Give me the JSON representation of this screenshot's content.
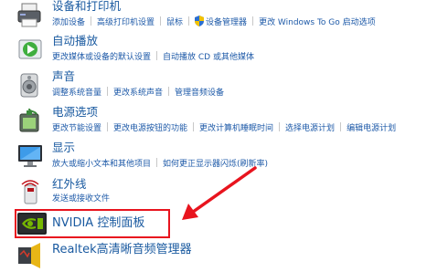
{
  "categories": [
    {
      "title": "设备和打印机",
      "icon": "printer-icon",
      "links": [
        "添加设备",
        "高级打印机设置",
        "鼠标",
        "设备管理器",
        "更改 Windows To Go 启动选项"
      ]
    },
    {
      "title": "自动播放",
      "icon": "autoplay-icon",
      "links": [
        "更改媒体或设备的默认设置",
        "自动播放 CD 或其他媒体"
      ]
    },
    {
      "title": "声音",
      "icon": "speaker-icon",
      "links": [
        "调整系统音量",
        "更改系统声音",
        "管理音频设备"
      ]
    },
    {
      "title": "电源选项",
      "icon": "power-options-icon",
      "links": [
        "更改节能设置",
        "更改电源按钮的功能",
        "更改计算机睡眠时间",
        "选择电源计划",
        "编辑电源计划"
      ]
    },
    {
      "title": "显示",
      "icon": "display-icon",
      "links": [
        "放大或缩小文本和其他项目",
        "如何更正显示器闪烁(刷新率)"
      ]
    },
    {
      "title": "红外线",
      "icon": "infrared-icon",
      "links": [
        "发送或接收文件"
      ]
    },
    {
      "title": "NVIDIA 控制面板",
      "icon": "nvidia-icon",
      "links": []
    },
    {
      "title": "Realtek高清晰音频管理器",
      "icon": "realtek-audio-icon",
      "links": []
    }
  ],
  "colors": {
    "link": "#1e5aa8",
    "title": "#1a5aa0",
    "highlight": "#e8141e"
  }
}
